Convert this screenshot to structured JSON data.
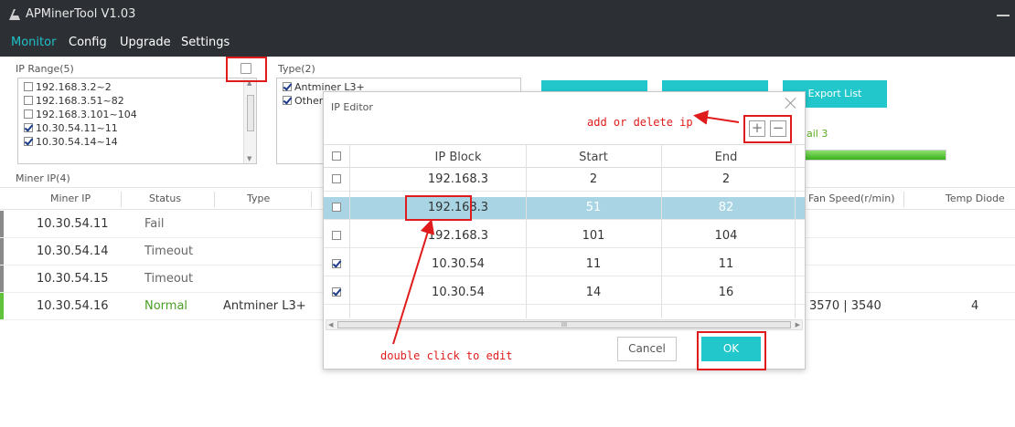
{
  "app": {
    "title": "APMinerTool V1.03"
  },
  "menu": [
    {
      "label": "Monitor",
      "active": true
    },
    {
      "label": "Config"
    },
    {
      "label": "Upgrade"
    },
    {
      "label": "Settings"
    }
  ],
  "ip_range": {
    "label": "IP Range(5)",
    "items": [
      {
        "label": "192.168.3.2~2",
        "checked": false
      },
      {
        "label": "192.168.3.51~82",
        "checked": false
      },
      {
        "label": "192.168.3.101~104",
        "checked": false
      },
      {
        "label": "10.30.54.11~11",
        "checked": true
      },
      {
        "label": "10.30.54.14~14",
        "checked": true
      }
    ]
  },
  "type_filter": {
    "label": "Type(2)",
    "items": [
      {
        "label": "Antminer L3+",
        "checked": true
      },
      {
        "label": "Other",
        "checked": true
      }
    ]
  },
  "actions": {
    "export_label": "Export List"
  },
  "scan_status": {
    "fail_text": "ail 3",
    "progress": 1.0
  },
  "miner_table": {
    "label": "Miner IP(4)",
    "headers": {
      "miner_ip": "Miner IP",
      "status": "Status",
      "type": "Type",
      "fan_speed": "Fan Speed(r/min)",
      "temp_diode": "Temp Diode"
    },
    "rows": [
      {
        "ip": "10.30.54.11",
        "status": "Fail",
        "type": "",
        "fan": "",
        "temp": ""
      },
      {
        "ip": "10.30.54.14",
        "status": "Timeout",
        "type": "",
        "fan": "",
        "temp": ""
      },
      {
        "ip": "10.30.54.15",
        "status": "Timeout",
        "type": "",
        "fan": "",
        "temp": ""
      },
      {
        "ip": "10.30.54.16",
        "status": "Normal",
        "type": "Antminer L3+",
        "fan": "3570 | 3540",
        "temp": "4"
      }
    ]
  },
  "ip_editor": {
    "title": "IP Editor",
    "annotation_add_delete": "add or delete ip",
    "annotation_double_click": "double click to edit",
    "add_symbol": "+",
    "remove_symbol": "−",
    "headers": {
      "ip_block": "IP Block",
      "start": "Start",
      "end": "End"
    },
    "rows": [
      {
        "block": "192.168.3",
        "start": "2",
        "end": "2",
        "checked": false
      },
      {
        "block": "192.168.3",
        "start": "51",
        "end": "82",
        "checked": false,
        "selected": true
      },
      {
        "block": "192.168.3",
        "start": "101",
        "end": "104",
        "checked": false
      },
      {
        "block": "10.30.54",
        "start": "11",
        "end": "11",
        "checked": true
      },
      {
        "block": "10.30.54",
        "start": "14",
        "end": "16",
        "checked": true
      }
    ],
    "scroll_grip": "III",
    "cancel_label": "Cancel",
    "ok_label": "OK"
  },
  "colors": {
    "accent": "#22c7cc",
    "annotation": "#e01b1b",
    "selected_row": "#a8d4e4",
    "titlebar": "#2c2f33",
    "ok_status": "#4a9e25"
  }
}
